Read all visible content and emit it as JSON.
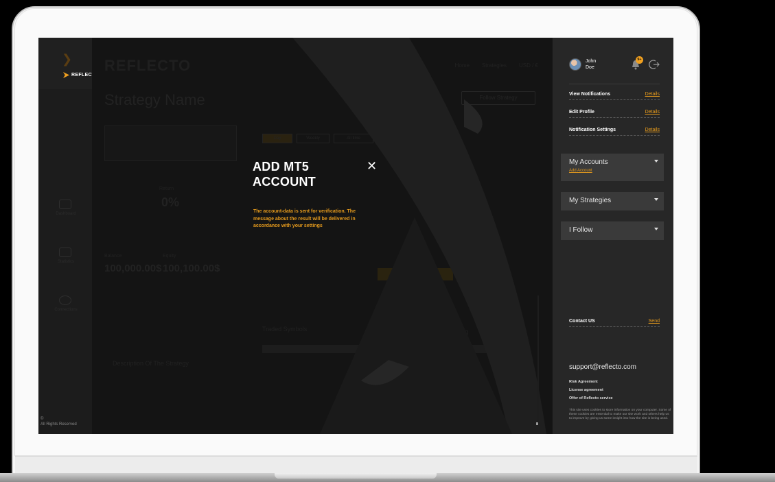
{
  "brand": {
    "name": "REFLECTO",
    "small_logo_text": "REFLECTO"
  },
  "app": {
    "topnav": [
      "Home",
      "Strategies",
      "USD / €"
    ],
    "strategy_title": "Strategy Name",
    "follow_button": "Follow Strategy",
    "return_label": "Return",
    "return_value": "0%",
    "balance_label": "Balance",
    "balance_value": "100,000.00$",
    "equity_label": "Equity",
    "equity_value": "100,100.00$",
    "traded_symbols": "Traded Symbols",
    "profitability": "Profitability of Trading",
    "description": "Description Of The Strategy",
    "tabs": [
      "Day",
      "Weekly",
      "All time"
    ]
  },
  "leftnav": {
    "copyright": "©\nAll Rights Reserved",
    "items": [
      "Dashboard",
      "Statistics",
      "Connections"
    ]
  },
  "modal": {
    "title": "ADD MT5 ACCOUNT",
    "close_label": "✕",
    "message": "The account-data is sent for verification. The message about the result will be delivered in accordance with your settings"
  },
  "sidebar": {
    "user": {
      "first_name": "John",
      "last_name": "Doe"
    },
    "notification_badge": "9+",
    "links": [
      {
        "label": "View Notifications",
        "action": "Details"
      },
      {
        "label": "Edit Profile",
        "action": "Details"
      },
      {
        "label": "Notification Settings",
        "action": "Details"
      }
    ],
    "accounts": {
      "label": "My Accounts",
      "sub_link": "Add Account"
    },
    "strategies": {
      "label": "My Strategies"
    },
    "follow": {
      "label": "I Follow"
    },
    "contact": {
      "label": "Contact US",
      "action": "Send"
    },
    "support_email": "support@reflecto.com",
    "legal": [
      "Risk Agreement",
      "License agreement",
      "Offer of Reflecto service"
    ],
    "cookie_notice": "This site uses cookies to store information on your computer. Some of these cookies are essential to make our site work and others help us to improve by giving us some insight into how the site is being used."
  },
  "colors": {
    "accent": "#e69b1d",
    "panel": "#272727",
    "background": "#151515"
  }
}
